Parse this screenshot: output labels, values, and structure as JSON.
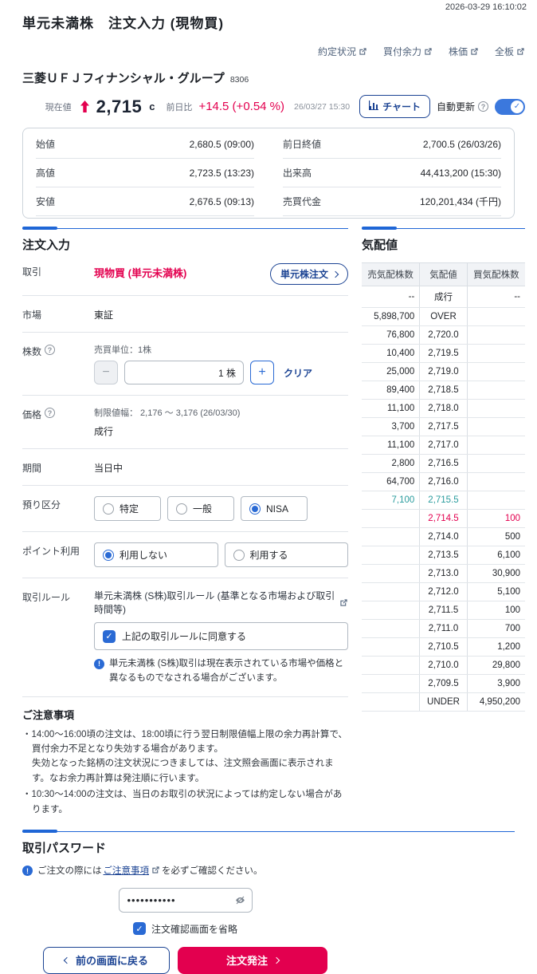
{
  "meta": {
    "timestamp": "2026-03-29 16:10:02"
  },
  "header": {
    "title": "単元未満株　注文入力 (現物買)",
    "links": [
      {
        "label": "約定状況"
      },
      {
        "label": "買付余力"
      },
      {
        "label": "株価"
      },
      {
        "label": "全板"
      }
    ]
  },
  "stock": {
    "name": "三菱ＵＦＪフィナンシャル・グループ",
    "code": "8306",
    "price_label": "現在値",
    "price": "2,715",
    "price_unit": "c",
    "change_label": "前日比",
    "change": "+14.5 (+0.54 %)",
    "as_of": "26/03/27 15:30",
    "chart_button": "チャート",
    "auto_update_label": "自動更新"
  },
  "summary": {
    "left": [
      {
        "label": "始値",
        "value": "2,680.5 (09:00)"
      },
      {
        "label": "高値",
        "value": "2,723.5 (13:23)"
      },
      {
        "label": "安値",
        "value": "2,676.5 (09:13)"
      }
    ],
    "right": [
      {
        "label": "前日終値",
        "value": "2,700.5 (26/03/26)"
      },
      {
        "label": "出来高",
        "value": "44,413,200 (15:30)"
      },
      {
        "label": "売買代金",
        "value": "120,201,434 (千円)"
      }
    ]
  },
  "order_form": {
    "heading": "注文入力",
    "trade": {
      "label": "取引",
      "value": "現物買 (単元未満株)",
      "button": "単元株注文"
    },
    "market": {
      "label": "市場",
      "value": "東証"
    },
    "quantity": {
      "label": "株数",
      "unit_note": "売買単位：1株",
      "value": "1 株",
      "clear": "クリア"
    },
    "price": {
      "label": "価格",
      "limit_note": "制限値幅： 2,176 ～ 3,176 (26/03/30)",
      "value": "成行"
    },
    "period": {
      "label": "期間",
      "value": "当日中"
    },
    "account": {
      "label": "預り区分",
      "options": [
        {
          "label": "特定",
          "selected": false
        },
        {
          "label": "一般",
          "selected": false
        },
        {
          "label": "NISA",
          "selected": true
        }
      ]
    },
    "points": {
      "label": "ポイント利用",
      "options": [
        {
          "label": "利用しない",
          "selected": true
        },
        {
          "label": "利用する",
          "selected": false
        }
      ]
    },
    "rules": {
      "label": "取引ルール",
      "link": "単元未満株 (S株)取引ルール (基準となる市場および取引時間等)",
      "agree": "上記の取引ルールに同意する",
      "note": "単元未満株 (S株)取引は現在表示されている市場や価格と異なるものでなされる場合がございます。"
    }
  },
  "notes": {
    "heading": "ご注意事項",
    "items": [
      "・14:00～16:00頃の注文は、18:00頃に行う翌日制限値幅上限の余力再計算で、買付余力不足となり失効する場合があります。\n失効となった銘柄の注文状況につきましては、注文照会画面に表示されます。なお余力再計算は発注順に行います。",
      "・10:30～14:00の注文は、当日のお取引の状況によっては約定しない場合があります。"
    ]
  },
  "password": {
    "heading": "取引パスワード",
    "notice_prefix": "ご注文の際には",
    "notice_link": "ご注意事項",
    "notice_suffix": "を必ずご確認ください。",
    "value": "•••••••••••",
    "skip_confirm": "注文確認画面を省略",
    "back_button": "前の画面に戻る",
    "submit_button": "注文発注"
  },
  "quote_board": {
    "heading": "気配値",
    "columns": [
      "売気配株数",
      "気配値",
      "買気配株数"
    ],
    "rows": [
      {
        "sell": "--",
        "price": "成行",
        "buy": "--",
        "highlight": ""
      },
      {
        "sell": "5,898,700",
        "price": "OVER",
        "buy": "",
        "highlight": ""
      },
      {
        "sell": "76,800",
        "price": "2,720.0",
        "buy": "",
        "highlight": ""
      },
      {
        "sell": "10,400",
        "price": "2,719.5",
        "buy": "",
        "highlight": ""
      },
      {
        "sell": "25,000",
        "price": "2,719.0",
        "buy": "",
        "highlight": ""
      },
      {
        "sell": "89,400",
        "price": "2,718.5",
        "buy": "",
        "highlight": ""
      },
      {
        "sell": "11,100",
        "price": "2,718.0",
        "buy": "",
        "highlight": ""
      },
      {
        "sell": "3,700",
        "price": "2,717.5",
        "buy": "",
        "highlight": ""
      },
      {
        "sell": "11,100",
        "price": "2,717.0",
        "buy": "",
        "highlight": ""
      },
      {
        "sell": "2,800",
        "price": "2,716.5",
        "buy": "",
        "highlight": ""
      },
      {
        "sell": "64,700",
        "price": "2,716.0",
        "buy": "",
        "highlight": ""
      },
      {
        "sell": "7,100",
        "price": "2,715.5",
        "buy": "",
        "highlight": "teal"
      },
      {
        "sell": "",
        "price": "2,714.5",
        "buy": "100",
        "highlight": "red"
      },
      {
        "sell": "",
        "price": "2,714.0",
        "buy": "500",
        "highlight": ""
      },
      {
        "sell": "",
        "price": "2,713.5",
        "buy": "6,100",
        "highlight": ""
      },
      {
        "sell": "",
        "price": "2,713.0",
        "buy": "30,900",
        "highlight": ""
      },
      {
        "sell": "",
        "price": "2,712.0",
        "buy": "5,100",
        "highlight": ""
      },
      {
        "sell": "",
        "price": "2,711.5",
        "buy": "100",
        "highlight": ""
      },
      {
        "sell": "",
        "price": "2,711.0",
        "buy": "700",
        "highlight": ""
      },
      {
        "sell": "",
        "price": "2,710.5",
        "buy": "1,200",
        "highlight": ""
      },
      {
        "sell": "",
        "price": "2,710.0",
        "buy": "29,800",
        "highlight": ""
      },
      {
        "sell": "",
        "price": "2,709.5",
        "buy": "3,900",
        "highlight": ""
      },
      {
        "sell": "",
        "price": "UNDER",
        "buy": "4,950,200",
        "highlight": ""
      }
    ]
  },
  "icons": {
    "minus": "−",
    "plus": "+",
    "help": "?",
    "info": "!",
    "check": "✓"
  },
  "colors": {
    "accent": "#1f66d6",
    "navy": "#1b4393",
    "crimson": "#e3004f",
    "teal": "#2a9c9e"
  }
}
